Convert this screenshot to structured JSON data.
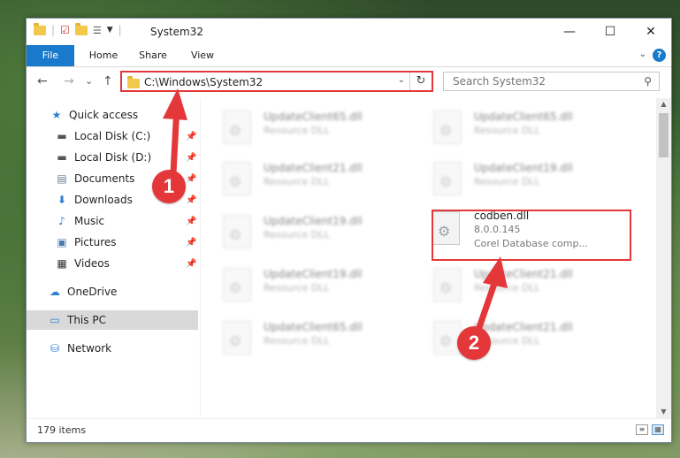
{
  "window": {
    "title": "System32",
    "controls": {
      "minimize": "—",
      "maximize": "☐",
      "close": "✕"
    }
  },
  "ribbon": {
    "tabs": [
      "File",
      "Home",
      "Share",
      "View"
    ],
    "help": "?"
  },
  "navbar": {
    "back": "←",
    "forward": "→",
    "recent": "⌄",
    "up": "↑",
    "address": "C:\\Windows\\System32",
    "refresh": "↻",
    "search_placeholder": "Search System32"
  },
  "sidebar": {
    "items": [
      {
        "label": "Quick access",
        "icon": "star-icon"
      },
      {
        "label": "Local Disk (C:)",
        "icon": "drive-icon",
        "pinned": true
      },
      {
        "label": "Local Disk (D:)",
        "icon": "drive-icon",
        "pinned": true
      },
      {
        "label": "Documents",
        "icon": "documents-icon",
        "pinned": true
      },
      {
        "label": "Downloads",
        "icon": "download-icon",
        "pinned": true
      },
      {
        "label": "Music",
        "icon": "music-icon",
        "pinned": true
      },
      {
        "label": "Pictures",
        "icon": "pictures-icon",
        "pinned": true
      },
      {
        "label": "Videos",
        "icon": "videos-icon",
        "pinned": true
      },
      {
        "label": "OneDrive",
        "icon": "cloud-icon"
      },
      {
        "label": "This PC",
        "icon": "computer-icon",
        "selected": true
      },
      {
        "label": "Network",
        "icon": "network-icon"
      }
    ]
  },
  "files": [
    {
      "name": "UpdateClient65.dll",
      "type": "Resource DLL"
    },
    {
      "name": "UpdateClient65.dll",
      "type": "Resource DLL"
    },
    {
      "name": "UpdateClient21.dll",
      "type": "Resource DLL"
    },
    {
      "name": "UpdateClient19.dll",
      "type": "Resource DLL"
    },
    {
      "name": "UpdateClient19.dll",
      "type": "Resource DLL"
    },
    {
      "name": "codben.dll",
      "version": "8.0.0.145",
      "description": "Corel Database comp...",
      "highlighted": true
    },
    {
      "name": "UpdateClient19.dll",
      "type": "Resource DLL"
    },
    {
      "name": "UpdateClient21.dll",
      "type": "Resource DLL"
    },
    {
      "name": "UpdateClient65.dll",
      "type": "Resource DLL"
    },
    {
      "name": "UpdateClient21.dll",
      "type": "Resource DLL"
    }
  ],
  "status": {
    "count": "179 items"
  },
  "annotations": {
    "callout_1": "1",
    "callout_2": "2"
  },
  "colors": {
    "accent": "#1979ca",
    "highlight": "#e4373a"
  }
}
